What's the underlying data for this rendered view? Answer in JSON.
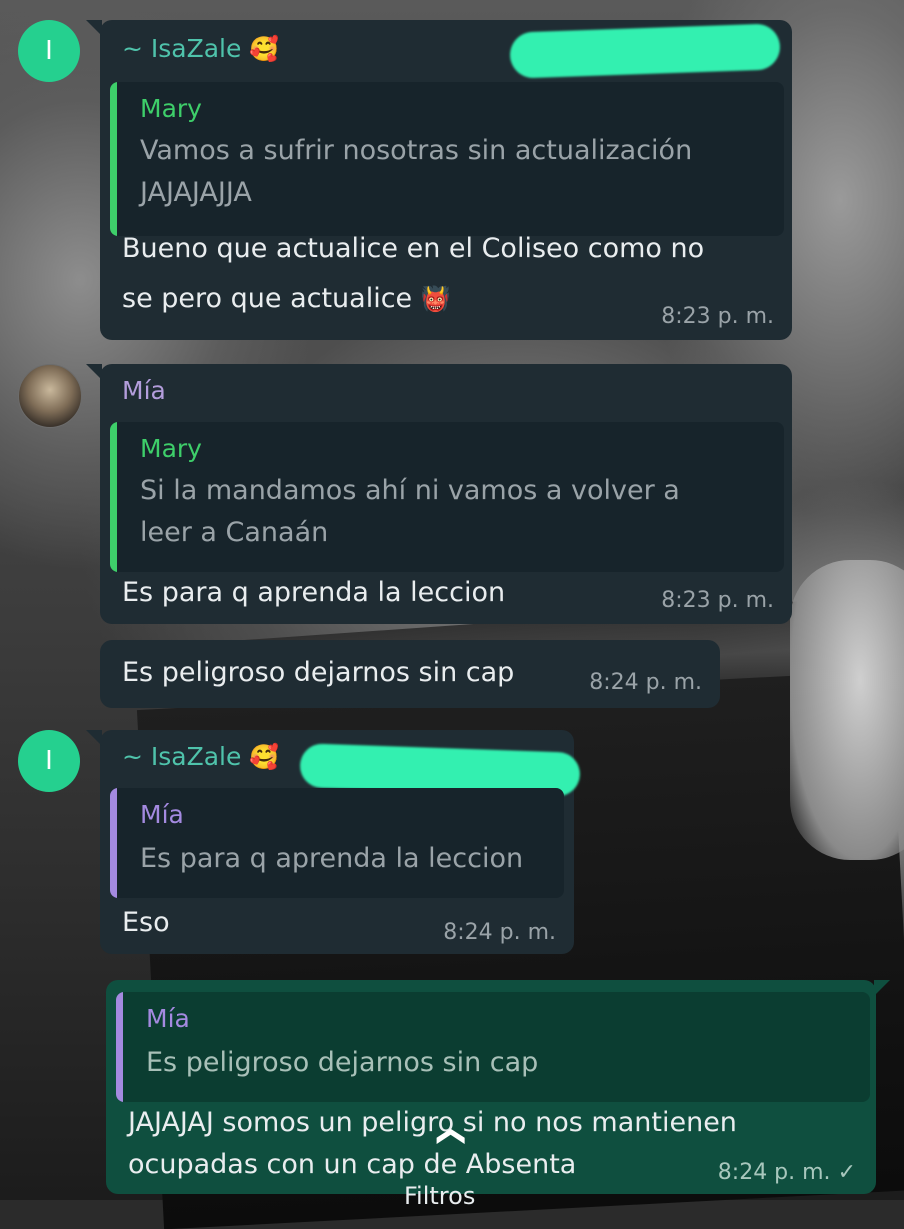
{
  "colors": {
    "incoming_bubble": "#1f2c33",
    "outgoing_bubble": "#0f4f3f",
    "sender_isazale": "#4fc3ab",
    "sender_mia": "#b39ddb",
    "quote_mary": "#3ecf6a",
    "quote_mia": "#a48ae0",
    "avatar_green": "#25d08f"
  },
  "messages": [
    {
      "sender": "~ IsaZale",
      "sender_emoji": "🥰",
      "avatar_letter": "I",
      "quote": {
        "author": "Mary",
        "lines": [
          "Vamos a sufrir nosotras sin actualización",
          "JAJAJAJJA"
        ]
      },
      "text_lines": [
        "Bueno que actualice en el Coliseo como no",
        "se pero que actualice"
      ],
      "text_emoji": "👹",
      "time": "8:23 p. m."
    },
    {
      "sender": "Mía",
      "avatar": "profile-photo",
      "quote": {
        "author": "Mary",
        "lines": [
          "Si la mandamos ahí ni vamos a volver a",
          "leer a Canaán"
        ]
      },
      "text": "Es para q aprenda la leccion",
      "time": "8:23 p. m."
    },
    {
      "text": "Es peligroso dejarnos sin cap",
      "time": "8:24 p. m."
    },
    {
      "sender": "~ IsaZale",
      "sender_emoji": "🥰",
      "avatar_letter": "I",
      "quote": {
        "author": "Mía",
        "lines": [
          "Es para q aprenda la leccion"
        ]
      },
      "text": "Eso",
      "time": "8:24 p. m."
    },
    {
      "outgoing": true,
      "quote": {
        "author": "Mía",
        "lines": [
          "Es peligroso dejarnos sin cap"
        ]
      },
      "text_lines": [
        "JAJAJAJ somos un peligro si no nos mantienen",
        "ocupadas con un cap de Absenta"
      ],
      "time": "8:24 p. m.",
      "status_icon": "✓"
    }
  ],
  "bottom": {
    "scroll_icon": "chevron-up-icon",
    "filter_label": "Filtros"
  }
}
